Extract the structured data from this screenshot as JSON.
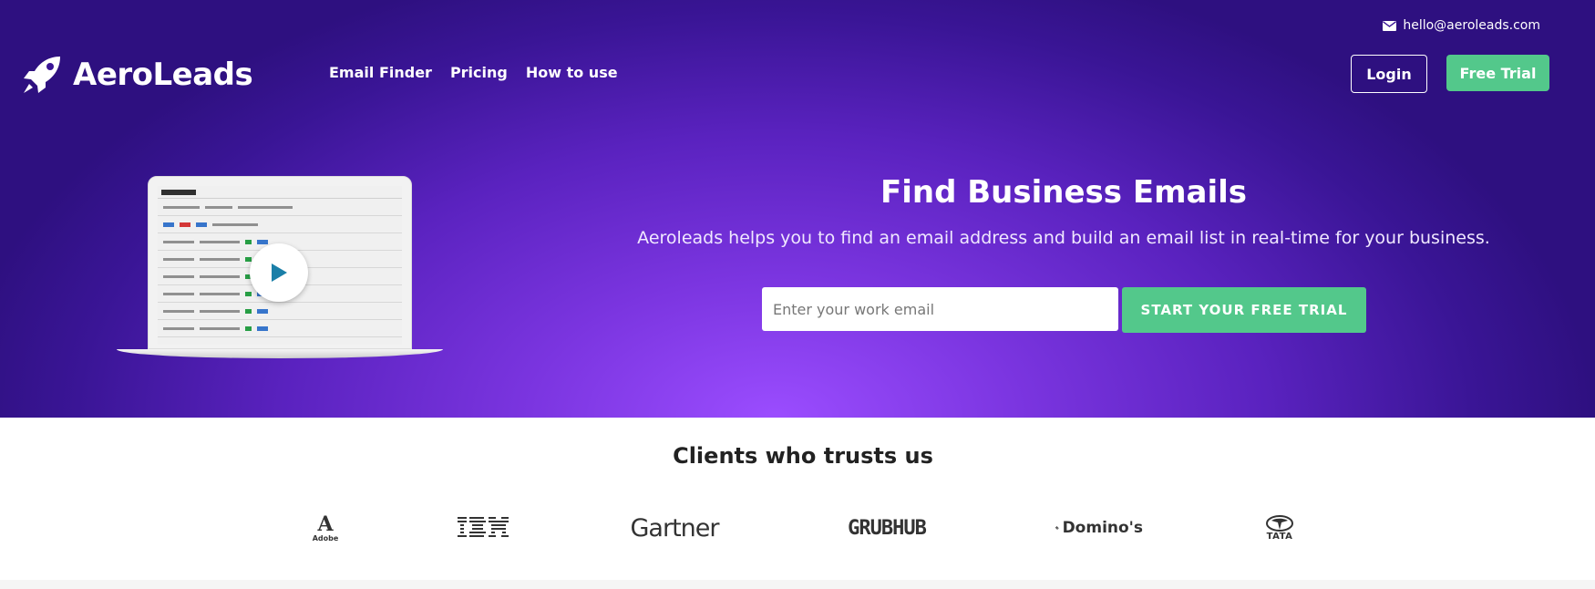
{
  "header": {
    "brand": "AeroLeads",
    "nav": [
      {
        "label": "Email Finder"
      },
      {
        "label": "Pricing"
      },
      {
        "label": "How to use"
      }
    ],
    "contact_email": "hello@aeroleads.com",
    "login_label": "Login",
    "free_trial_label": "Free Trial"
  },
  "hero": {
    "title": "Find Business Emails",
    "subtitle": "Aeroleads helps you to find an email address and build an email list in real-time for your business.",
    "email_placeholder": "Enter your work email",
    "email_value": "",
    "cta_label": "START YOUR FREE TRIAL"
  },
  "clients": {
    "title": "Clients who trusts us",
    "logos": [
      {
        "name": "Adobe",
        "text": "Adobe"
      },
      {
        "name": "IBM",
        "text": "IBM"
      },
      {
        "name": "Gartner",
        "text": "Gartner"
      },
      {
        "name": "GRUBHUB",
        "text": "GRUBHUB"
      },
      {
        "name": "Domino's",
        "text": "Domino's"
      },
      {
        "name": "TATA",
        "text": "TATA"
      }
    ]
  },
  "colors": {
    "hero_deep": "#2e1080",
    "hero_light": "#9b4dff",
    "accent_green": "#53c88b",
    "text_dark": "#222222"
  },
  "icons": {
    "logo": "rocket-icon",
    "contact": "envelope-icon",
    "video": "play-icon"
  }
}
